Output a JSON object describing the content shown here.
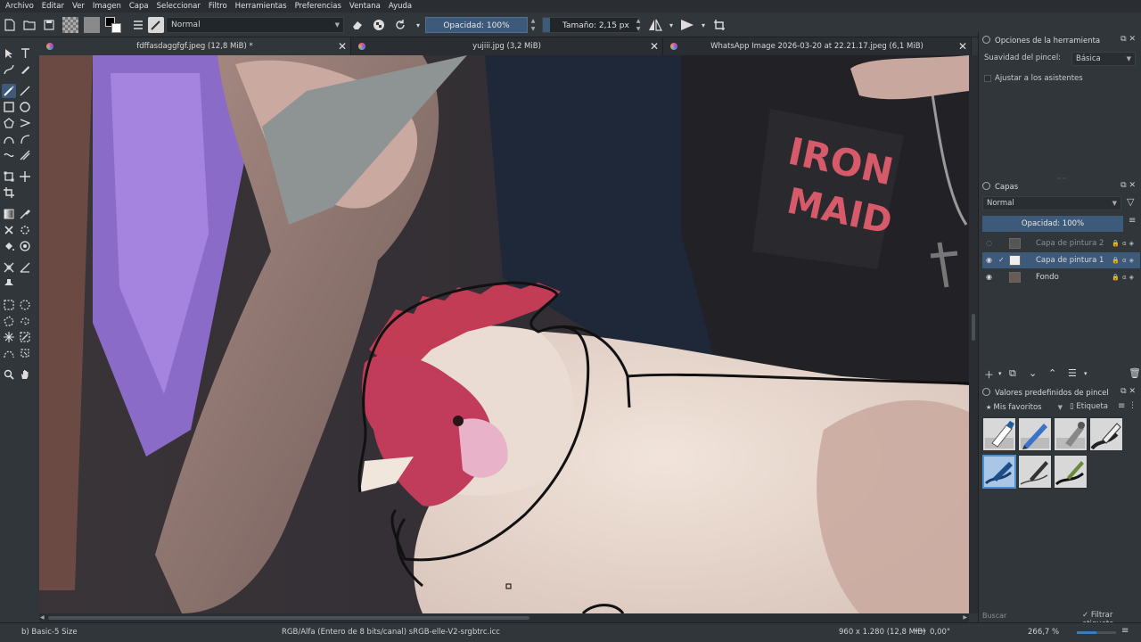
{
  "menu": [
    "Archivo",
    "Editar",
    "Ver",
    "Imagen",
    "Capa",
    "Seleccionar",
    "Filtro",
    "Herramientas",
    "Preferencias",
    "Ventana",
    "Ayuda"
  ],
  "toolbar": {
    "blend_mode": "Normal",
    "opacity_label": "Opacidad: 100%",
    "size_label": "Tamaño: 2,15 px"
  },
  "tabs": [
    {
      "title": "fdffasdaggfgf.jpeg (12,8 MiB) *",
      "active": true
    },
    {
      "title": "yujiii.jpg (3,2 MiB)",
      "active": false
    },
    {
      "title": "WhatsApp Image 2026-03-20 at 22.21.17.jpeg (6,1 MiB)",
      "active": false
    }
  ],
  "tool_options": {
    "title": "Opciones de la herramienta",
    "smoothing_label": "Suavidad del pincel:",
    "smoothing_value": "Básica",
    "snap_label": "Ajustar a los asistentes"
  },
  "layers": {
    "title": "Capas",
    "blend_mode": "Normal",
    "opacity_label": "Opacidad:  100%",
    "items": [
      {
        "name": "Capa de pintura 2",
        "visible": false,
        "selected": false
      },
      {
        "name": "Capa de pintura 1",
        "visible": true,
        "selected": true
      },
      {
        "name": "Fondo",
        "visible": true,
        "selected": false
      }
    ]
  },
  "brush_presets": {
    "title": "Valores predefinidos de pincel",
    "tag_combo": "Mis favoritos",
    "tag_label": "Etiqueta",
    "search_placeholder": "Buscar",
    "filter_label": "Filtrar etiqueta",
    "presets": [
      "eraser",
      "pencil-blue",
      "airbrush",
      "ink-pen",
      "brush-pen",
      "pencil-sketch",
      "marker",
      "fineliner"
    ]
  },
  "status": {
    "brush": "b) Basic-5 Size",
    "color_space": "RGB/Alfa (Entero de 8 bits/canal)  sRGB-elle-V2-srgbtrc.icc",
    "dimensions": "960 x 1.280 (12,8 MiB)",
    "rotation": "0,00°",
    "zoom": "266,7 %"
  }
}
